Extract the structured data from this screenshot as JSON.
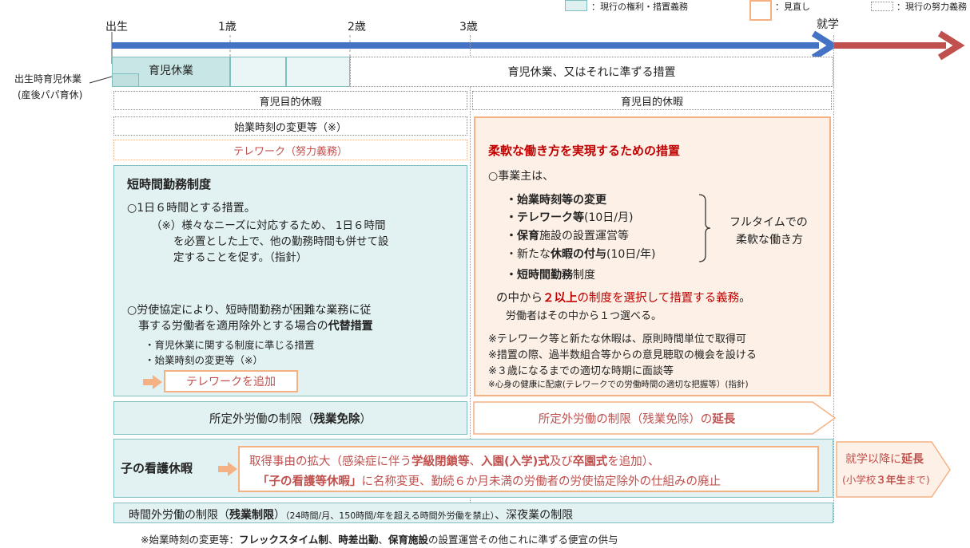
{
  "legend": {
    "current": "：現行の権利・措置義務",
    "review": "：見直し",
    "effort": "：現行の努力義務"
  },
  "timeline": {
    "birth": "出生",
    "y1": "1歳",
    "y2": "2歳",
    "y3": "3歳",
    "school": "就学"
  },
  "side_label": {
    "line1": "出生時育児休業",
    "line2": "(産後パパ育休)"
  },
  "childcare_leave": "育児休業",
  "childcare_leave_or_equiv": "育児休業、又はそれに準ずる措置",
  "purpose_leave_left": "育児目的休暇",
  "purpose_leave_right": "育児目的休暇",
  "start_time_change": "始業時刻の変更等（※）",
  "telework_effort": "テレワーク（努力義務）",
  "short_time": {
    "title": "短時間勤務制度",
    "p1": "○1日６時間とする措置。",
    "p1_note1": "（※）様々なニーズに対応するため、 1日６時間",
    "p1_note2": "を必置とした上で、他の勤務時間も併せて設",
    "p1_note3": "定することを促す。（指針）",
    "p2_l1": "○労使協定により、短時間勤務が困難な業務に従",
    "p2_l2a": "事する労働者を適用除外とする場合の",
    "p2_l2b": "代替措置",
    "b1": "・育児休業に関する制度に準じる措置",
    "b2": "・始業時刻の変更等（※）",
    "add_button": "テレワークを追加"
  },
  "flex": {
    "title": "柔軟な働き方を実現するための措置",
    "employer": "○事業主は、",
    "i1": "・始業時刻等の変更",
    "i2a": "・テレワーク等",
    "i2b": "(10日/月)",
    "i3a": "・保育",
    "i3b": "施設の設置運営等",
    "i4a": "・新たな",
    "i4b": "休暇の付与",
    "i4c": "(10日/年)",
    "i5a": "・短時間勤務",
    "i5b": "制度",
    "brace_l1": "フルタイムでの",
    "brace_l2": "柔軟な働き方",
    "oblig_a": "の中から",
    "oblig_b": "２以上",
    "oblig_c": "の制度を選択して措置する義務",
    "oblig_d": "。",
    "worker": "労働者はその中から１つ選べる。",
    "n1": "※テレワーク等と新たな休暇は、原則時間単位で取得可",
    "n2": "※措置の際、過半数組合等からの意見聴取の機会を設ける",
    "n3": "※３歳になるまでの適切な時期に面談等",
    "n4": "※心身の健康に配慮(テレワークでの労働時間の適切な把握等）(指針)"
  },
  "overtime_left_a": "所定外労働の制限（",
  "overtime_left_b": "残業免除",
  "overtime_left_c": "）",
  "overtime_right_a": "所定外労働の制限（残業免除）の",
  "overtime_right_b": "延長",
  "sick_leave": {
    "title": "子の看護休暇",
    "l1a": "取得事由の拡大（感染症に伴う",
    "l1b": "学級閉鎖等",
    "l1c": "、",
    "l1d": "入園(入学)式",
    "l1e": "及び",
    "l1f": "卒園式",
    "l1g": "を追加）、",
    "l2a": "「子の看護等休暇」",
    "l2b": "に名称変更、勤続６か月未満の労働者の労使協定除外の仕組みの廃止",
    "ext_a": "就学以降に",
    "ext_b": "延長",
    "ext_c": "(小学校",
    "ext_d": "３年生",
    "ext_e": "まで)"
  },
  "overtime_limit": {
    "a": "時間外労働の制限（",
    "b": "残業制限",
    "c": "）",
    "small": "（24時間/月、150時間/年を超える時間外労働を禁止）",
    "d": "、深夜業の制限"
  },
  "footnote": {
    "a": "※始業時刻の変更等：",
    "b": "フレックスタイム制",
    "c": "、",
    "d": "時差出勤",
    "e": "、",
    "f": "保育施設",
    "g": "の設置運営その他これに準ずる便宜の供与"
  }
}
